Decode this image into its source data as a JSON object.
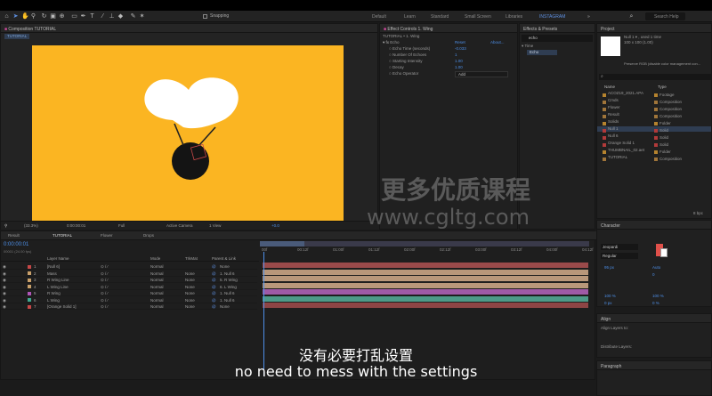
{
  "menubar": {
    "search_placeholder": "Search Help",
    "snapping": "Snapping"
  },
  "workspaces": [
    "Default",
    "Learn",
    "Standard",
    "Small Screen",
    "Libraries",
    "INSTAGRAM"
  ],
  "composition_panel": {
    "tab": "Composition TUTORIAL",
    "sub_tab": "TUTORIAL",
    "zoom": "(33.3%)",
    "timecode": "0:00:00:01",
    "resolution": "Full",
    "camera": "Active Camera",
    "views": "1 View",
    "offset": "+0.0"
  },
  "effect_controls": {
    "tab": "Effect Controls 1. Wing",
    "layer": "TUTORIAL • 1. Wing",
    "effect_name": "Echo",
    "reset": "Reset",
    "about": "About...",
    "params": [
      {
        "name": "Echo Time (seconds)",
        "value": "-0.033"
      },
      {
        "name": "Number Of Echoes",
        "value": "1"
      },
      {
        "name": "Starting Intensity",
        "value": "1.00"
      },
      {
        "name": "Decay",
        "value": "1.00"
      },
      {
        "name": "Echo Operator",
        "value": "Add"
      }
    ]
  },
  "effects_presets": {
    "tab": "Effects & Presets",
    "search": "echo",
    "group": "Time",
    "item": "Echo"
  },
  "project": {
    "tab": "Project",
    "info_line1": "Null 1 ▾ , used 1 time",
    "info_line2": "100 x 100 (1.00)",
    "preview_note": "Preserve RGB (disable color management con...",
    "col_name": "Name",
    "col_type": "Type",
    "items": [
      {
        "name": "ACOZ19_2021.APA",
        "type": "Footage",
        "color": "#b5832e"
      },
      {
        "name": "Cmds",
        "type": "Composition",
        "color": "#a0753a"
      },
      {
        "name": "Flower",
        "type": "Composition",
        "color": "#a0753a"
      },
      {
        "name": "Result",
        "type": "Composition",
        "color": "#a0753a"
      },
      {
        "name": "Solids",
        "type": "Folder",
        "color": "#b5832e"
      },
      {
        "name": "Null 1",
        "type": "Solid",
        "color": "#b23a3a"
      },
      {
        "name": "Null 6",
        "type": "Solid",
        "color": "#b23a3a"
      },
      {
        "name": "Orange Solid 1",
        "type": "Solid",
        "color": "#b23a3a"
      },
      {
        "name": "THUMBNAIL_02.aet",
        "type": "Folder",
        "color": "#b5832e"
      },
      {
        "name": "TUTORIAL",
        "type": "Composition",
        "color": "#a0753a"
      }
    ],
    "footer_depth": "8 bpc"
  },
  "character": {
    "tab": "Character",
    "font": "Jeopardi",
    "style": "Regular",
    "size": "95 px",
    "leading": "Auto",
    "tracking": "0",
    "scale_v": "100 %",
    "scale_h": "100 %",
    "baseline": "0 px",
    "tsume": "0 %"
  },
  "align": {
    "tab": "Align",
    "align_to": "Align Layers to:",
    "distribute": "Distribute Layers:"
  },
  "paragraph": {
    "tab": "Paragraph"
  },
  "timeline": {
    "tabs": [
      "Result",
      "TUTORIAL",
      "Flower",
      "Drops"
    ],
    "timecode": "0:00:00:01",
    "fps": "00001 (24.00 fps)",
    "col_layer": "Layer Name",
    "col_mode": "Mode",
    "col_trkmat": "TrkMat",
    "col_parent": "Parent & Link",
    "layers": [
      {
        "num": "1",
        "name": "[Null 6]",
        "mode": "Normal",
        "trk": "",
        "parent": "None",
        "color": "#c74848",
        "bar": "#9a4a4a"
      },
      {
        "num": "2",
        "name": "Mass",
        "mode": "Normal",
        "trk": "None",
        "parent": "1. Null 6",
        "color": "#c9a06a",
        "bar": "#b8977a"
      },
      {
        "num": "3",
        "name": "R Wing Line",
        "mode": "Normal",
        "trk": "None",
        "parent": "5. R Wing",
        "color": "#c9a06a",
        "bar": "#b8977a"
      },
      {
        "num": "4",
        "name": "L Wing Line",
        "mode": "Normal",
        "trk": "None",
        "parent": "6. L Wing",
        "color": "#c9a06a",
        "bar": "#b8977a"
      },
      {
        "num": "5",
        "name": "R Wing",
        "mode": "Normal",
        "trk": "None",
        "parent": "1. Null 6",
        "color": "#b055b8",
        "bar": "#9f5aa6"
      },
      {
        "num": "6",
        "name": "L Wing",
        "mode": "Normal",
        "trk": "None",
        "parent": "1. Null 6",
        "color": "#3fa88f",
        "bar": "#4d9a88"
      },
      {
        "num": "7",
        "name": "[Orange Solid 1]",
        "mode": "Normal",
        "trk": "None",
        "parent": "None",
        "color": "#c74848",
        "bar": "#8d4545"
      }
    ],
    "ruler": [
      "00f",
      "00:12f",
      "01:00f",
      "01:12f",
      "02:00f",
      "02:12f",
      "03:00f",
      "03:12f",
      "04:00f",
      "04:12f"
    ]
  },
  "watermark": {
    "line1": "更多优质课程",
    "line2": "www.cgltg.com"
  },
  "subtitles": {
    "zh": "没有必要打乱设置",
    "en": "no need to mess with the settings"
  },
  "colors": {
    "canvas": "#fbb522",
    "accent_blue": "#4d8fe8",
    "wing": "#ffffff",
    "body": "#141414"
  }
}
